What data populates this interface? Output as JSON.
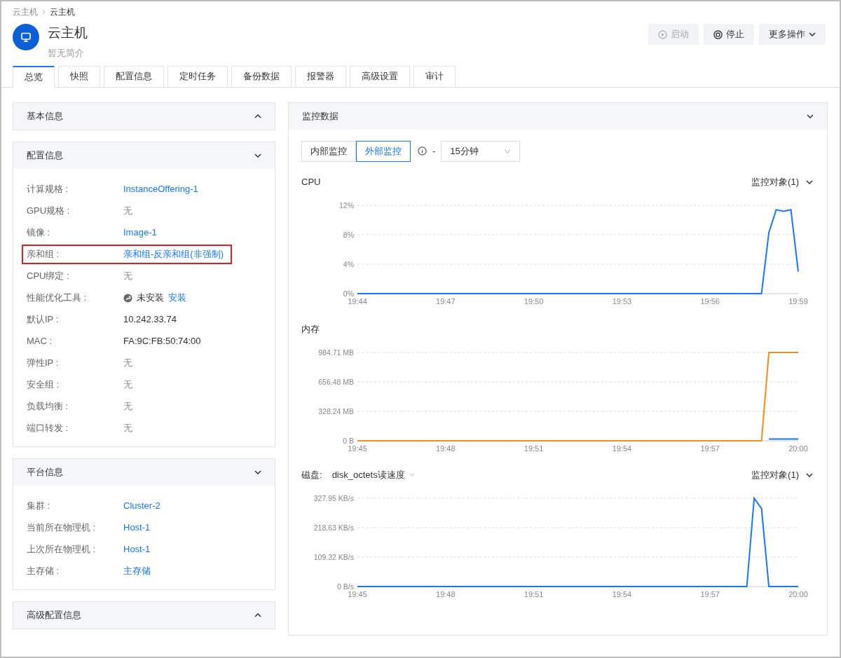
{
  "breadcrumb": [
    {
      "label": "云主机",
      "current": false
    },
    {
      "label": "云主机",
      "current": true
    }
  ],
  "header": {
    "title": "云主机",
    "subtitle": "暂无简介"
  },
  "actions": [
    {
      "label": "启动",
      "kind": "start",
      "disabled": true
    },
    {
      "label": "停止",
      "kind": "stop",
      "disabled": false
    },
    {
      "label": "更多操作",
      "kind": "menu",
      "disabled": false
    }
  ],
  "tabs": [
    {
      "label": "总览",
      "selected": true
    },
    {
      "label": "快照",
      "selected": false
    },
    {
      "label": "配置信息",
      "selected": false
    },
    {
      "label": "定时任务",
      "selected": false
    },
    {
      "label": "备份数据",
      "selected": false
    },
    {
      "label": "报警器",
      "selected": false
    },
    {
      "label": "高级设置",
      "selected": false
    },
    {
      "label": "审计",
      "selected": false
    }
  ],
  "sections": [
    {
      "title": "基本信息",
      "expanded": false
    },
    {
      "title": "配置信息",
      "expanded": true,
      "rows": [
        {
          "label": "计算规格 :",
          "value": "InstanceOffering-1",
          "kind": "link",
          "highlighted": false
        },
        {
          "label": "GPU规格 :",
          "value": "无",
          "kind": "muted",
          "highlighted": false
        },
        {
          "label": "镜像 :",
          "value": "Image-1",
          "kind": "link",
          "highlighted": false
        },
        {
          "label": "亲和组 :",
          "value": "亲和组-反亲和组(非强制)",
          "kind": "link",
          "highlighted": true
        },
        {
          "label": "CPU绑定 :",
          "value": "无",
          "kind": "muted",
          "highlighted": false
        },
        {
          "label": "性能优化工具 :",
          "value": "未安装",
          "action": "安装",
          "kind": "tool",
          "highlighted": false
        },
        {
          "label": "默认IP :",
          "value": "10.242.33.74",
          "kind": "text",
          "highlighted": false
        },
        {
          "label": "MAC :",
          "value": "FA:9C:FB:50:74:00",
          "kind": "text",
          "highlighted": false
        },
        {
          "label": "弹性IP :",
          "value": "无",
          "kind": "muted",
          "highlighted": false
        },
        {
          "label": "安全组 :",
          "value": "无",
          "kind": "muted",
          "highlighted": false
        },
        {
          "label": "负载均衡 :",
          "value": "无",
          "kind": "muted",
          "highlighted": false
        },
        {
          "label": "端口转发 :",
          "value": "无",
          "kind": "muted",
          "highlighted": false
        }
      ]
    },
    {
      "title": "平台信息",
      "expanded": true,
      "rows": [
        {
          "label": "集群 :",
          "value": "Cluster-2",
          "kind": "link",
          "highlighted": false
        },
        {
          "label": "当前所在物理机 :",
          "value": "Host-1",
          "kind": "link",
          "highlighted": false
        },
        {
          "label": "上次所在物理机 :",
          "value": "Host-1",
          "kind": "link",
          "highlighted": false
        },
        {
          "label": "主存储 :",
          "value": "主存储",
          "kind": "link",
          "highlighted": false
        }
      ]
    },
    {
      "title": "高级配置信息",
      "expanded": false
    }
  ],
  "monitor": {
    "title": "监控数据",
    "expanded": true,
    "modes": [
      {
        "label": "内部监控",
        "selected": false
      },
      {
        "label": "外部监控",
        "selected": true
      }
    ],
    "separator": "-",
    "range": "15分钟",
    "charts": [
      {
        "title": "CPU",
        "target": "监控对象(1)",
        "chart_data": {
          "type": "line",
          "categories": [
            "19:44",
            null,
            null,
            null,
            null,
            null,
            null,
            null,
            null,
            null,
            null,
            null,
            "19:47",
            null,
            null,
            null,
            null,
            null,
            null,
            null,
            null,
            null,
            null,
            null,
            "19:50",
            null,
            null,
            null,
            null,
            null,
            null,
            null,
            null,
            null,
            null,
            null,
            "19:53",
            null,
            null,
            null,
            null,
            null,
            null,
            null,
            null,
            null,
            null,
            null,
            "19:56",
            null,
            null,
            null,
            null,
            null,
            null,
            null,
            null,
            null,
            null,
            null,
            "19:59"
          ],
          "ylim": [
            0,
            12
          ],
          "yticks": [
            {
              "value": 0,
              "label": "0%"
            },
            {
              "value": 4,
              "label": "4%"
            },
            {
              "value": 8,
              "label": "8%"
            },
            {
              "value": 12,
              "label": "12%"
            }
          ],
          "series": [
            {
              "color": "#1677ff",
              "values": [
                0,
                0,
                0,
                0,
                0,
                0,
                0,
                0,
                0,
                0,
                0,
                0,
                0,
                0,
                0,
                0,
                0,
                0,
                0,
                0,
                0,
                0,
                0,
                0,
                0,
                0,
                0,
                0,
                0,
                0,
                0,
                0,
                0,
                0,
                0,
                0,
                0,
                0,
                0,
                0,
                0,
                0,
                0,
                0,
                0,
                0,
                0,
                0,
                0,
                0,
                0,
                0,
                0,
                0,
                0,
                0,
                8.3,
                11.4,
                11.2,
                11.4,
                3
              ]
            }
          ]
        }
      },
      {
        "title": "内存",
        "chart_data": {
          "type": "line",
          "categories": [
            "19:45",
            null,
            null,
            null,
            null,
            null,
            null,
            null,
            null,
            null,
            null,
            null,
            "19:48",
            null,
            null,
            null,
            null,
            null,
            null,
            null,
            null,
            null,
            null,
            null,
            "19:51",
            null,
            null,
            null,
            null,
            null,
            null,
            null,
            null,
            null,
            null,
            null,
            "19:54",
            null,
            null,
            null,
            null,
            null,
            null,
            null,
            null,
            null,
            null,
            null,
            "19:57",
            null,
            null,
            null,
            null,
            null,
            null,
            null,
            null,
            null,
            null,
            null,
            "20:00"
          ],
          "ylim": [
            0,
            984.71
          ],
          "yticks": [
            {
              "value": 0,
              "label": "0 B"
            },
            {
              "value": 328.24,
              "label": "328.24 MB"
            },
            {
              "value": 656.48,
              "label": "656.48 MB"
            },
            {
              "value": 984.71,
              "label": "984.71 MB"
            }
          ],
          "series": [
            {
              "color": "#fa8c16",
              "values": [
                0,
                0,
                0,
                0,
                0,
                0,
                0,
                0,
                0,
                0,
                0,
                0,
                0,
                0,
                0,
                0,
                0,
                0,
                0,
                0,
                0,
                0,
                0,
                0,
                0,
                0,
                0,
                0,
                0,
                0,
                0,
                0,
                0,
                0,
                0,
                0,
                0,
                0,
                0,
                0,
                0,
                0,
                0,
                0,
                0,
                0,
                0,
                0,
                0,
                0,
                0,
                0,
                0,
                0,
                0,
                0,
                984.71,
                984.71,
                984.71,
                984.71,
                984.71
              ]
            },
            {
              "color": "#1677ff",
              "values": [
                null,
                null,
                null,
                null,
                null,
                null,
                null,
                null,
                null,
                null,
                null,
                null,
                null,
                null,
                null,
                null,
                null,
                null,
                null,
                null,
                null,
                null,
                null,
                null,
                null,
                null,
                null,
                null,
                null,
                null,
                null,
                null,
                null,
                null,
                null,
                null,
                null,
                null,
                null,
                null,
                null,
                null,
                null,
                null,
                null,
                null,
                null,
                null,
                null,
                null,
                null,
                null,
                null,
                null,
                null,
                null,
                20,
                20,
                20,
                20,
                20
              ]
            }
          ]
        }
      },
      {
        "title": "磁盘:",
        "metric": "disk_octets读速度",
        "target": "监控对象(1)",
        "chart_data": {
          "type": "line",
          "categories": [
            "19:45",
            null,
            null,
            null,
            null,
            null,
            null,
            null,
            null,
            null,
            null,
            null,
            "19:48",
            null,
            null,
            null,
            null,
            null,
            null,
            null,
            null,
            null,
            null,
            null,
            "19:51",
            null,
            null,
            null,
            null,
            null,
            null,
            null,
            null,
            null,
            null,
            null,
            "19:54",
            null,
            null,
            null,
            null,
            null,
            null,
            null,
            null,
            null,
            null,
            null,
            "19:57",
            null,
            null,
            null,
            null,
            null,
            null,
            null,
            null,
            null,
            null,
            null,
            "20:00"
          ],
          "ylim": [
            0,
            327.95
          ],
          "yticks": [
            {
              "value": 0,
              "label": "0 B/s"
            },
            {
              "value": 109.32,
              "label": "109.32 KB/s"
            },
            {
              "value": 218.63,
              "label": "218.63 KB/s"
            },
            {
              "value": 327.95,
              "label": "327.95 KB/s"
            }
          ],
          "series": [
            {
              "color": "#1677ff",
              "values": [
                0,
                0,
                0,
                0,
                0,
                0,
                0,
                0,
                0,
                0,
                0,
                0,
                0,
                0,
                0,
                0,
                0,
                0,
                0,
                0,
                0,
                0,
                0,
                0,
                0,
                0,
                0,
                0,
                0,
                0,
                0,
                0,
                0,
                0,
                0,
                0,
                0,
                0,
                0,
                0,
                0,
                0,
                0,
                0,
                0,
                0,
                0,
                0,
                0,
                0,
                0,
                0,
                0,
                0,
                327.95,
                290,
                0,
                0,
                0,
                0,
                0
              ]
            }
          ]
        }
      }
    ]
  }
}
